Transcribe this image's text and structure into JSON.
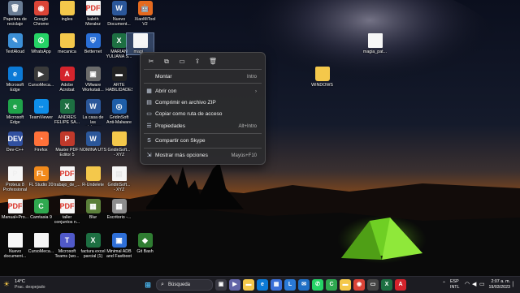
{
  "desktop": {
    "icons": [
      {
        "label": "Papelera de\nreciclaje",
        "glyph": "🗑",
        "color": "#6a7d95",
        "kind": "app"
      },
      {
        "label": "Google\nChrome",
        "glyph": "◉",
        "color": "#db4437",
        "kind": "app"
      },
      {
        "label": "ingles",
        "glyph": "",
        "color": "#f4c84b",
        "kind": "folder"
      },
      {
        "label": "kaleth\nMoralez",
        "glyph": "PDF",
        "color": "#d93025",
        "kind": "doc"
      },
      {
        "label": "Nuevo\nDocument...",
        "glyph": "W",
        "color": "#2b579a",
        "kind": "app"
      },
      {
        "label": "XiaoMiTool\nV2",
        "glyph": "🤖",
        "color": "#e56a1f",
        "kind": "app"
      },
      {
        "label": "TextAloud",
        "glyph": "✎",
        "color": "#3c8fd6",
        "kind": "app"
      },
      {
        "label": "WhatsApp",
        "glyph": "✆",
        "color": "#25d366",
        "kind": "app"
      },
      {
        "label": "mecanica",
        "glyph": "",
        "color": "#f4c84b",
        "kind": "folder"
      },
      {
        "label": "Betternet",
        "glyph": "⛨",
        "color": "#2a6fd6",
        "kind": "app"
      },
      {
        "label": "MARIAN\nYULIANA S...",
        "glyph": "X",
        "color": "#1d6f42",
        "kind": "app"
      },
      {
        "label": "magi...",
        "glyph": "",
        "color": "#e8e8e8",
        "kind": "doc"
      },
      {
        "label": "Microsoft\nEdge",
        "glyph": "e",
        "color": "#0c7ad6",
        "kind": "app"
      },
      {
        "label": "CursoMeca...",
        "glyph": "▶",
        "color": "#3a3a3a",
        "kind": "app"
      },
      {
        "label": "Adobe\nAcrobat",
        "glyph": "A",
        "color": "#d4242c",
        "kind": "app"
      },
      {
        "label": "VMware\nWorkstati...",
        "glyph": "▣",
        "color": "#6b6b6b",
        "kind": "app"
      },
      {
        "label": "ARTE\nHABILIDADES",
        "glyph": "▬",
        "color": "#222222",
        "kind": "app"
      },
      {
        "label": "Microsoft\nEdge",
        "glyph": "e",
        "color": "#1fa34a",
        "kind": "app"
      },
      {
        "label": "TeamViewer",
        "glyph": "⇔",
        "color": "#0e8ee9",
        "kind": "app"
      },
      {
        "label": "ANDRES\nFELIPE SA...",
        "glyph": "X",
        "color": "#1d6f42",
        "kind": "app"
      },
      {
        "label": "La casa de las\npinturas",
        "glyph": "W",
        "color": "#2b579a",
        "kind": "app"
      },
      {
        "label": "GridinSoft\nAnti-Malware",
        "glyph": "◎",
        "color": "#1e5ea8",
        "kind": "app"
      },
      {
        "label": "Dev-C++",
        "glyph": "DEV",
        "color": "#3050a0",
        "kind": "app"
      },
      {
        "label": "Firefox",
        "glyph": "◔",
        "color": "#ff7139",
        "kind": "app"
      },
      {
        "label": "Master PDF\nEditor 5",
        "glyph": "P",
        "color": "#c0392b",
        "kind": "app"
      },
      {
        "label": "NOMINA UTS",
        "glyph": "W",
        "color": "#2b579a",
        "kind": "app"
      },
      {
        "label": "GridinSoft...\n- XYZ",
        "glyph": "",
        "color": "#f4c84b",
        "kind": "folder"
      },
      {
        "label": "Proteus 8\nProfessional",
        "glyph": "P",
        "color": "#f0f0f0",
        "kind": "doc"
      },
      {
        "label": "FL Studio 20",
        "glyph": "FL",
        "color": "#f28a1b",
        "kind": "app"
      },
      {
        "label": "trabajo_de_...",
        "glyph": "PDF",
        "color": "#d93025",
        "kind": "doc"
      },
      {
        "label": "R-Undelete",
        "glyph": "",
        "color": "#f4c84b",
        "kind": "folder"
      },
      {
        "label": "GridinSoft...\n- XYZ",
        "glyph": "▤",
        "color": "#e8e8e8",
        "kind": "doc"
      },
      {
        "label": "Manual+Pro...",
        "glyph": "PDF",
        "color": "#d93025",
        "kind": "doc"
      },
      {
        "label": "Camtasia 9",
        "glyph": "C",
        "color": "#2fa84f",
        "kind": "app"
      },
      {
        "label": "taller\nconjuntos n...",
        "glyph": "PDF",
        "color": "#d93025",
        "kind": "doc"
      },
      {
        "label": "Blur",
        "glyph": "▦",
        "color": "#5b7f3a",
        "kind": "app"
      },
      {
        "label": "Escritorio -...",
        "glyph": "▦",
        "color": "#8d8d8d",
        "kind": "app"
      },
      {
        "label": "Nuevo\ndocument...",
        "glyph": "",
        "color": "#f0f0f0",
        "kind": "doc"
      },
      {
        "label": "CursoMeca...",
        "glyph": "",
        "color": "#f0f0f0",
        "kind": "doc"
      },
      {
        "label": "Microsoft\nTeams (wo...",
        "glyph": "T",
        "color": "#5059c9",
        "kind": "app"
      },
      {
        "label": "factura excel\nparcial (1)",
        "glyph": "X",
        "color": "#1d6f42",
        "kind": "app"
      },
      {
        "label": "Minimal ADB\nand Fastboot",
        "glyph": "▣",
        "color": "#2e6fd8",
        "kind": "app"
      },
      {
        "label": "Git Bash",
        "glyph": "◆",
        "color": "#2f7d32",
        "kind": "app"
      },
      {
        "label": "magia_pat...",
        "glyph": "",
        "color": "#f0f0f0",
        "kind": "doc"
      },
      {
        "label": "WINDOWS",
        "glyph": "",
        "color": "#f4c84b",
        "kind": "folder"
      }
    ]
  },
  "context_menu": {
    "quick_actions": [
      {
        "name": "cut-icon",
        "glyph": "✂"
      },
      {
        "name": "copy-icon",
        "glyph": "⧉"
      },
      {
        "name": "rename-icon",
        "glyph": "▭"
      },
      {
        "name": "share-icon",
        "glyph": "⇪"
      },
      {
        "name": "delete-icon",
        "glyph": "🗑"
      }
    ],
    "items": [
      {
        "label": "Montar",
        "shortcut": "Intro",
        "icon": "",
        "icon_name": "mount-icon"
      },
      {
        "label": "Abrir con",
        "shortcut": "›",
        "icon": "▦",
        "icon_name": "open-with-icon"
      },
      {
        "label": "Comprimir en archivo ZIP",
        "shortcut": "",
        "icon": "▤",
        "icon_name": "zip-icon"
      },
      {
        "label": "Copiar como ruta de acceso",
        "shortcut": "",
        "icon": "▭",
        "icon_name": "copy-path-icon"
      },
      {
        "label": "Propiedades",
        "shortcut": "Alt+Intro",
        "icon": "☰",
        "icon_name": "properties-icon"
      },
      {
        "label": "Compartir con Skype",
        "shortcut": "",
        "icon": "S",
        "icon_name": "skype-icon"
      },
      {
        "label": "Mostrar más opciones",
        "shortcut": "Mayús+F10",
        "icon": "⇲",
        "icon_name": "more-options-icon"
      }
    ]
  },
  "taskbar": {
    "weather": {
      "temp": "14°C",
      "desc": "Prac. despejado"
    },
    "search_label": "Búsqueda",
    "apps": [
      {
        "name": "task-view-icon",
        "glyph": "▣",
        "color": "#3a3a44"
      },
      {
        "name": "meet-icon",
        "glyph": "▶",
        "color": "#6264a7"
      },
      {
        "name": "explorer-icon",
        "glyph": "▬",
        "color": "#f4c84b"
      },
      {
        "name": "edge-icon",
        "glyph": "e",
        "color": "#0c7ad6"
      },
      {
        "name": "store-icon",
        "glyph": "▦",
        "color": "#3a6fd8"
      },
      {
        "name": "lmms-icon",
        "glyph": "L",
        "color": "#2a7ad6"
      },
      {
        "name": "mail-icon",
        "glyph": "✉",
        "color": "#1f6fc5"
      },
      {
        "name": "whatsapp-icon",
        "glyph": "✆",
        "color": "#25d366"
      },
      {
        "name": "camtasia-icon",
        "glyph": "C",
        "color": "#2fa84f"
      },
      {
        "name": "files-icon",
        "glyph": "▬",
        "color": "#f4c84b"
      },
      {
        "name": "chrome-icon",
        "glyph": "◉",
        "color": "#db4437"
      },
      {
        "name": "terminal-icon",
        "glyph": "▭",
        "color": "#444"
      },
      {
        "name": "excel-icon",
        "glyph": "X",
        "color": "#1d6f42"
      },
      {
        "name": "pdf-icon",
        "glyph": "A",
        "color": "#d4242c"
      }
    ],
    "tray": {
      "lang1": "ESP",
      "lang2": "INTL",
      "time": "2:07 a. m.",
      "date": "19/03/2023"
    }
  }
}
